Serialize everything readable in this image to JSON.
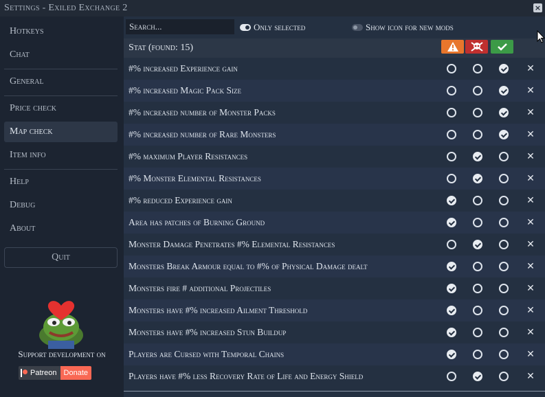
{
  "window": {
    "title": "Settings - Exiled Exchange 2",
    "close_glyph": "×"
  },
  "sidebar": {
    "items": [
      {
        "label": "Hotkeys",
        "active": false
      },
      {
        "label": "Chat",
        "active": false
      },
      {
        "label": "General",
        "active": false
      },
      {
        "label": "Price check",
        "active": false
      },
      {
        "label": "Map check",
        "active": true
      },
      {
        "label": "Item info",
        "active": false
      },
      {
        "label": "Help",
        "active": false
      },
      {
        "label": "Debug",
        "active": false
      },
      {
        "label": "About",
        "active": false
      }
    ],
    "quit_label": "Quit",
    "support_text": "Support development on",
    "patreon_label": "Patreon",
    "donate_label": "Donate"
  },
  "toolbar": {
    "search_placeholder": "Search...",
    "search_value": "",
    "only_selected_label": "Only selected",
    "only_selected_on": true,
    "show_icon_label": "Show icon for new mods",
    "show_icon_on": false
  },
  "table": {
    "header_label": "Stat (found: 15)",
    "columns": [
      {
        "icon": "warning-icon",
        "color": "#e8762c"
      },
      {
        "icon": "skull-icon",
        "color": "#c0302f"
      },
      {
        "icon": "check-icon",
        "color": "#3c9a47"
      }
    ],
    "rows": [
      {
        "text": "#% increased Experience gain",
        "selected": 3
      },
      {
        "text": "#% increased Magic Pack Size",
        "selected": 3
      },
      {
        "text": "#% increased number of Monster Packs",
        "selected": 3
      },
      {
        "text": "#% increased number of Rare Monsters",
        "selected": 3
      },
      {
        "text": "#% maximum Player Resistances",
        "selected": 2
      },
      {
        "text": "#% Monster Elemental Resistances",
        "selected": 2
      },
      {
        "text": "#% reduced Experience gain",
        "selected": 1
      },
      {
        "text": "Area has patches of Burning Ground",
        "selected": 1
      },
      {
        "text": "Monster Damage Penetrates #% Elemental Resistances",
        "selected": 2
      },
      {
        "text": "Monsters Break Armour equal to #% of Physical Damage dealt",
        "selected": 1
      },
      {
        "text": "Monsters fire # additional Projectiles",
        "selected": 1
      },
      {
        "text": "Monsters have #% increased Ailment Threshold",
        "selected": 1
      },
      {
        "text": "Monsters have #% increased Stun Buildup",
        "selected": 1
      },
      {
        "text": "Players are Cursed with Temporal Chains",
        "selected": 1
      },
      {
        "text": "Players have #% less Recovery Rate of Life and Energy Shield",
        "selected": 2
      }
    ]
  }
}
